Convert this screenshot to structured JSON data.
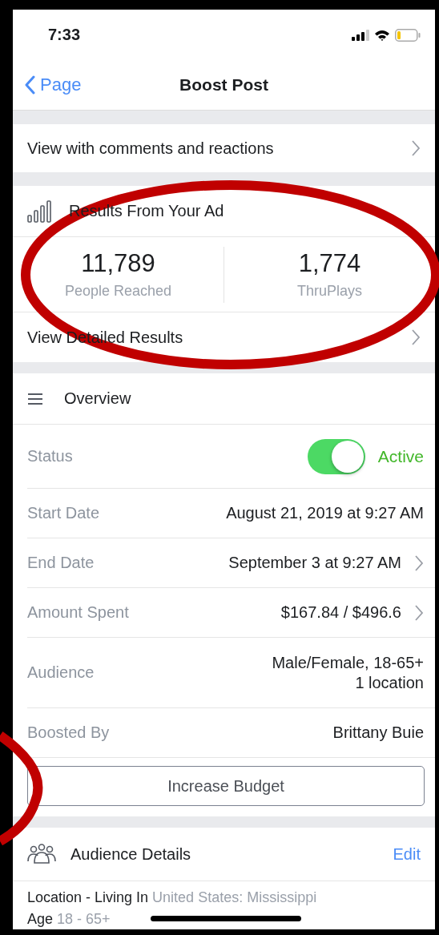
{
  "status_bar": {
    "time": "7:33"
  },
  "nav": {
    "back": "Page",
    "title": "Boost Post"
  },
  "link_row": {
    "label": "View with comments and reactions"
  },
  "results": {
    "title": "Results From Your Ad",
    "stats": [
      {
        "value": "11,789",
        "label": "People Reached"
      },
      {
        "value": "1,774",
        "label": "ThruPlays"
      }
    ],
    "link": "View Detailed Results"
  },
  "overview": {
    "title": "Overview",
    "rows": [
      {
        "kind": "toggle",
        "label": "Status",
        "on": true,
        "value": "Active"
      },
      {
        "kind": "text",
        "label": "Start Date",
        "value": [
          "August 21, 2019 at 9:27 AM"
        ],
        "chevron": false
      },
      {
        "kind": "text",
        "label": "End Date",
        "value": [
          "September 3 at 9:27 AM"
        ],
        "chevron": true
      },
      {
        "kind": "text",
        "label": "Amount Spent",
        "value": [
          "$167.84 / $496.6"
        ],
        "chevron": true
      },
      {
        "kind": "text",
        "label": "Audience",
        "value": [
          "Male/Female, 18-65+",
          "1 location"
        ],
        "chevron": false
      },
      {
        "kind": "text",
        "label": "Boosted By",
        "value": [
          "Brittany Buie"
        ],
        "chevron": false
      }
    ],
    "button": "Increase Budget"
  },
  "audience": {
    "title": "Audience Details",
    "edit": "Edit",
    "details": [
      {
        "label": "Location - Living In",
        "value": "United States: Mississippi"
      },
      {
        "label": "Age",
        "value": "18 - 65+"
      }
    ]
  }
}
